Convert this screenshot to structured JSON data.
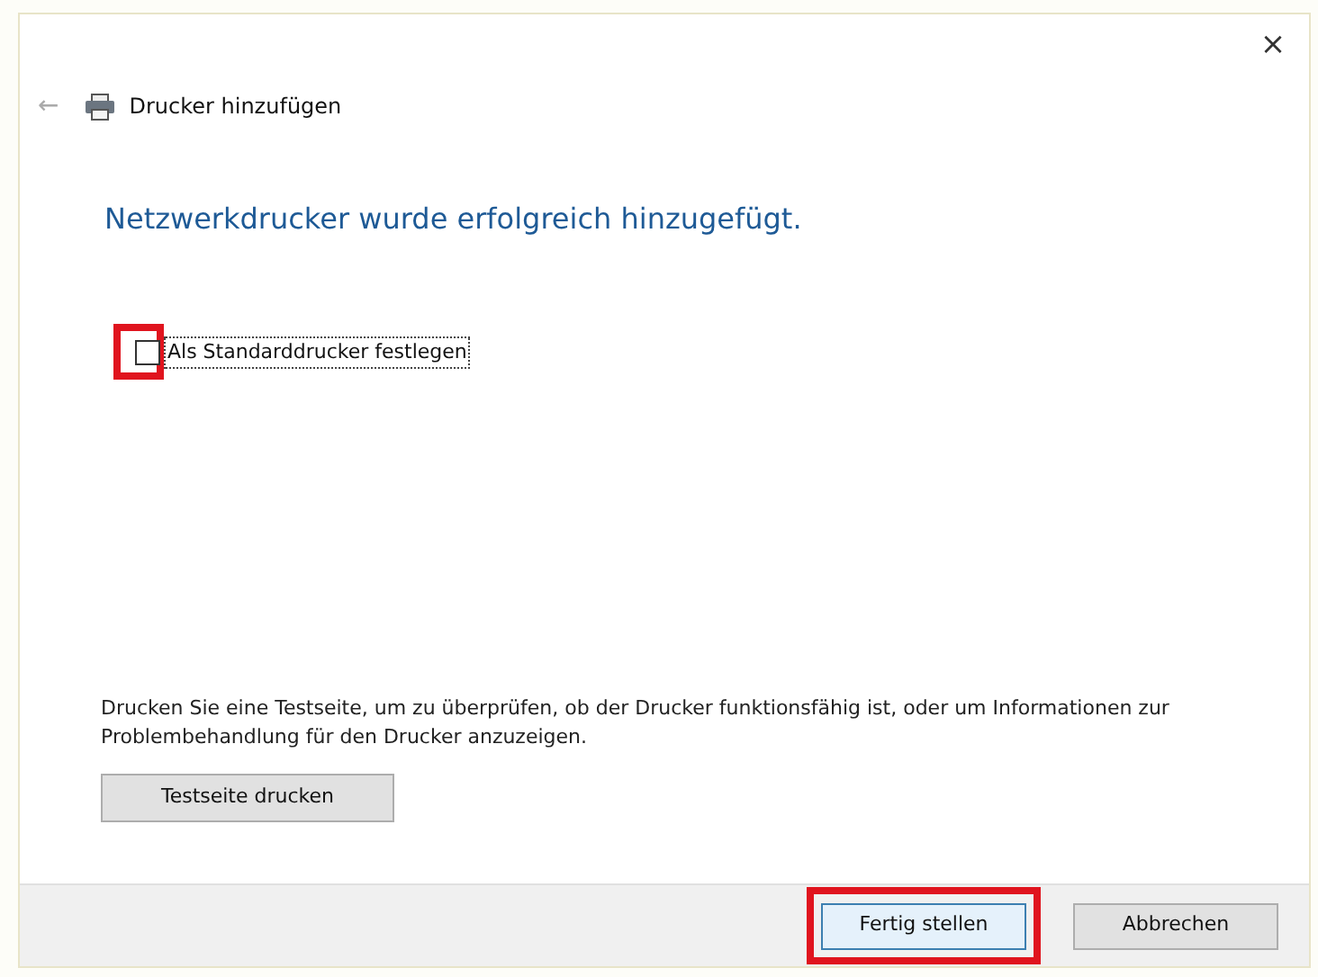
{
  "window": {
    "title": "Drucker hinzufügen",
    "close": "×",
    "back": "←"
  },
  "heading": "Netzwerkdrucker wurde erfolgreich hinzugefügt.",
  "checkbox": {
    "label": "Als Standarddrucker festlegen",
    "checked": false,
    "focused": true,
    "highlighted": true
  },
  "info": "Drucken Sie eine Testseite, um zu überprüfen, ob der Drucker funktionsfähig ist, oder um Informationen zur Problembehandlung für den Drucker anzuzeigen.",
  "test_button": "Testseite drucken",
  "buttons": [
    {
      "label": "Fertig stellen",
      "kind": "default",
      "highlighted": true
    },
    {
      "label": "Abbrechen",
      "kind": "normal",
      "highlighted": false
    }
  ]
}
